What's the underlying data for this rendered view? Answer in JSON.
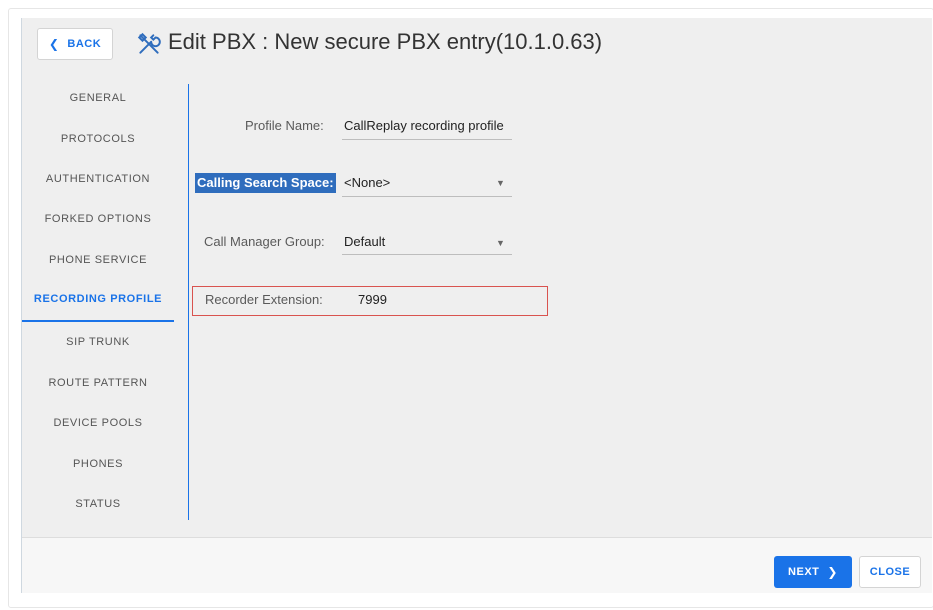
{
  "header": {
    "back_label": "BACK",
    "title": "Edit PBX : New secure PBX entry(10.1.0.63)",
    "title_icon": "tools-icon"
  },
  "sidebar": {
    "items": [
      {
        "label": "GENERAL",
        "active": false
      },
      {
        "label": "PROTOCOLS",
        "active": false
      },
      {
        "label": "AUTHENTICATION",
        "active": false
      },
      {
        "label": "FORKED OPTIONS",
        "active": false
      },
      {
        "label": "PHONE SERVICE",
        "active": false
      },
      {
        "label": "RECORDING PROFILE",
        "active": true
      },
      {
        "label": "SIP TRUNK",
        "active": false
      },
      {
        "label": "ROUTE PATTERN",
        "active": false
      },
      {
        "label": "DEVICE POOLS",
        "active": false
      },
      {
        "label": "PHONES",
        "active": false
      },
      {
        "label": "STATUS",
        "active": false
      }
    ]
  },
  "form": {
    "profile_name": {
      "label": "Profile Name:",
      "value": "CallReplay recording profile"
    },
    "calling_search_space": {
      "label": "Calling Search Space:",
      "value": "<None>"
    },
    "call_manager_group": {
      "label": "Call Manager Group:",
      "value": "Default"
    },
    "recorder_extension": {
      "label": "Recorder Extension:",
      "value": "7999"
    }
  },
  "footer": {
    "next_label": "NEXT",
    "close_label": "CLOSE"
  },
  "colors": {
    "accent": "#1a73e8",
    "highlight": "#2f6dbd",
    "callout": "#d9534f",
    "panel_bg": "#efefef"
  }
}
